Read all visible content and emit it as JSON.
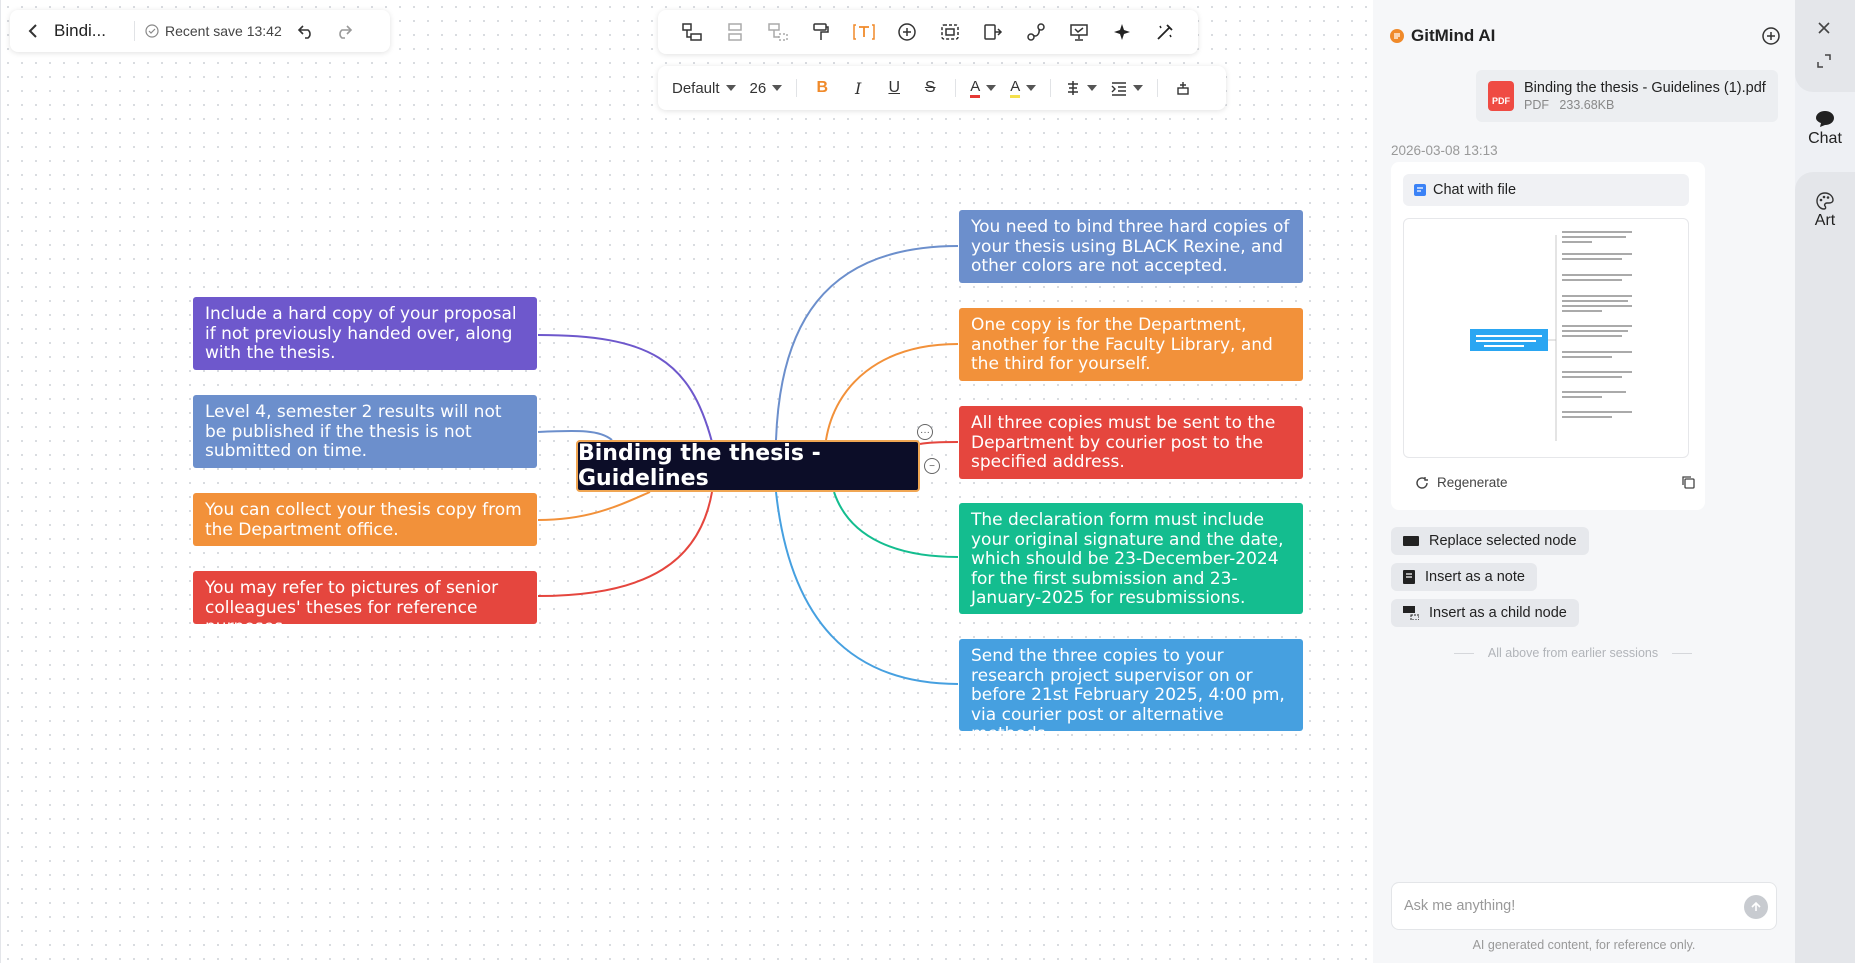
{
  "top_left": {
    "title": "Bindi...",
    "save_status": "Recent save 13:42"
  },
  "toolbar": {
    "icons": [
      "sibling-node-icon",
      "child-node-icon",
      "parent-node-icon",
      "format-painter-icon",
      "text-icon",
      "add-icon",
      "summary-icon",
      "boundary-icon",
      "relation-icon",
      "presentation-icon",
      "ai-sparkle-icon",
      "magic-wand-icon"
    ]
  },
  "format_bar": {
    "font_style": "Default",
    "font_size": "26",
    "bold": "B",
    "italic": "I",
    "underline": "U",
    "strike": "S",
    "font_color_label": "A",
    "highlight_label": "A",
    "font_color": "#e53935",
    "highlight_color": "#f4e04d"
  },
  "mindmap": {
    "root": "Binding the thesis - Guidelines",
    "left_nodes": [
      {
        "text": "Include a hard copy of your proposal if not previously handed over, along with the thesis.",
        "color": "#6e58cc"
      },
      {
        "text": "Level 4, semester 2 results will not be published if the thesis is not submitted on time.",
        "color": "#6c8fcc"
      },
      {
        "text": "You can collect your thesis copy from the Department office.",
        "color": "#f2913a"
      },
      {
        "text": "You may refer to pictures of senior colleagues' theses for reference purposes.",
        "color": "#e5463e"
      }
    ],
    "right_nodes": [
      {
        "text": "You need to bind three hard copies of your thesis using BLACK Rexine, and other colors are not accepted.",
        "color": "#6c8fcc"
      },
      {
        "text": "One copy is for the Department, another for the Faculty Library, and the third for yourself.",
        "color": "#f2913a"
      },
      {
        "text": "All three copies must be sent to the Department by courier post to the specified address.",
        "color": "#e5463e"
      },
      {
        "text": "The declaration form must include your original signature and the date, which should be 23-December-2024 for the first submission and 23-January-2025 for resubmissions.",
        "color": "#14bd8f"
      },
      {
        "text": "Send the three copies to your research project supervisor on or before 21st February 2025, 4:00 pm, via courier post or alternative methods.",
        "color": "#46a0e0"
      }
    ]
  },
  "ai_panel": {
    "brand": "GitMind AI",
    "file_name": "Binding the thesis - Guidelines (1).pdf",
    "file_type": "PDF",
    "file_size": "233.68KB",
    "pdf_badge": "PDF",
    "timestamp": "2026-03-08 13:13",
    "chat_with_file": "Chat with file",
    "regenerate": "Regenerate",
    "actions": [
      "Replace selected node",
      "Insert as a note",
      "Insert as a child node"
    ],
    "earlier_sessions": "All above from earlier sessions",
    "input_placeholder": "Ask me anything!",
    "disclaimer": "AI generated content, for reference only."
  },
  "rail": {
    "chat": "Chat",
    "art": "Art"
  }
}
